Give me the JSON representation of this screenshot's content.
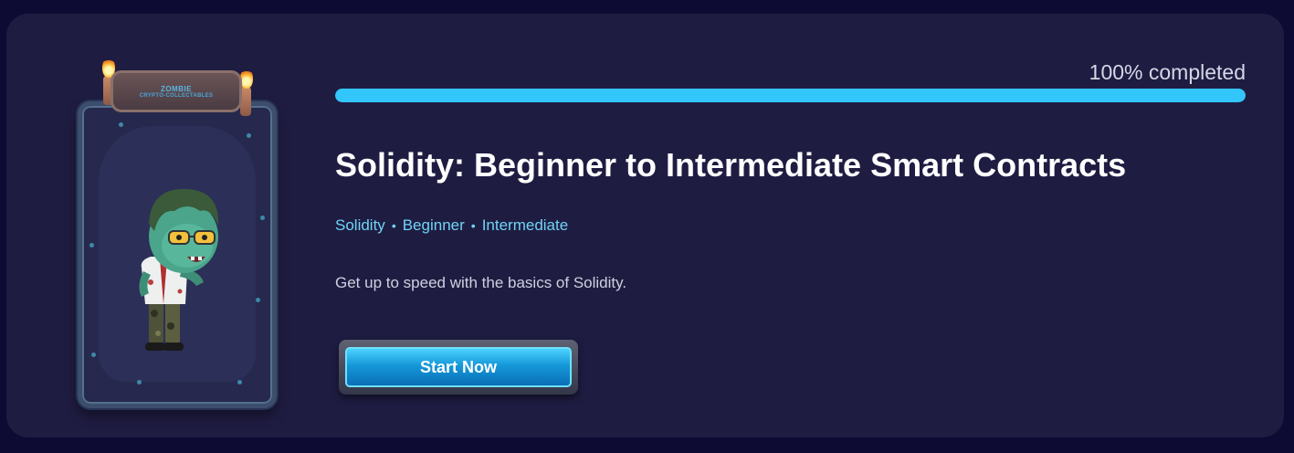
{
  "card": {
    "art": {
      "plaque_title": "ZOMBIE",
      "plaque_subtitle": "CRYPTO-COLLECTABLES",
      "character": "zombie-character"
    },
    "progress": {
      "label": "100% completed",
      "fraction": 1.0,
      "color": "#33c6fb"
    },
    "title": "Solidity: Beginner to Intermediate Smart Contracts",
    "tags": [
      "Solidity",
      "Beginner",
      "Intermediate"
    ],
    "tag_separator": "•",
    "description": "Get up to speed with the basics of Solidity.",
    "button_label": "Start Now"
  },
  "colors": {
    "page_bg": "#0d0b33",
    "card_bg": "#1f1c42",
    "accent": "#33c6fb",
    "tag_text": "#6fd4f5"
  }
}
